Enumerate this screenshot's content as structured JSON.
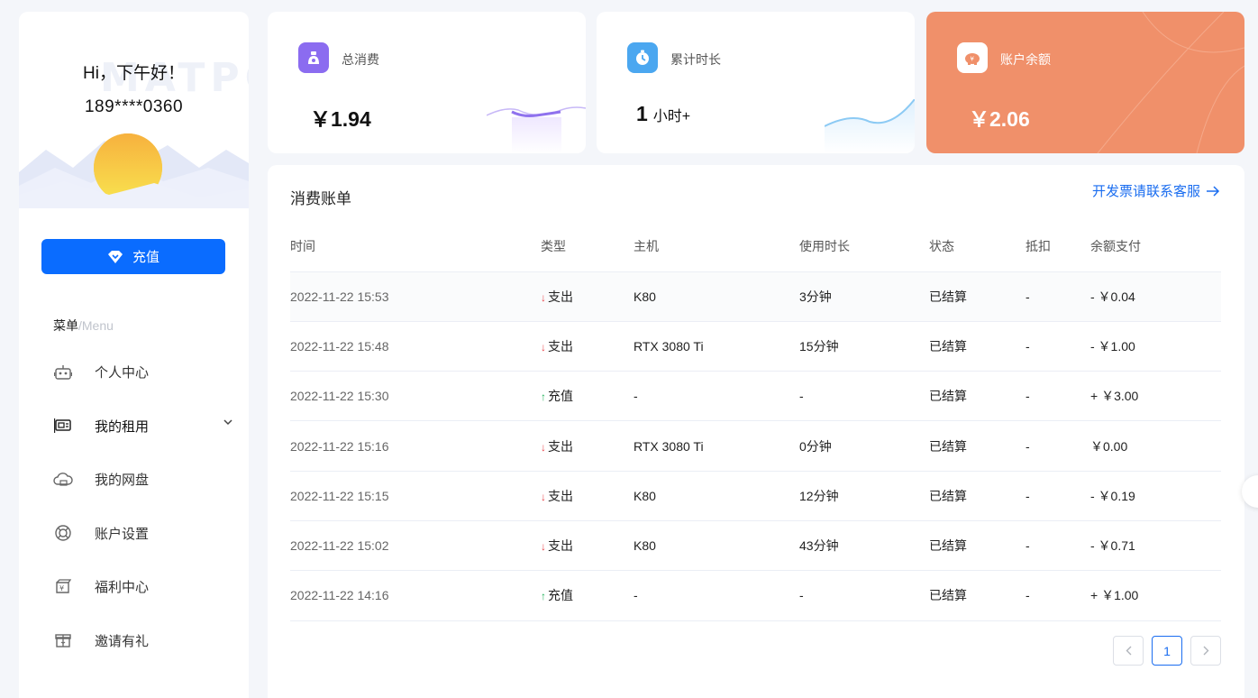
{
  "sidebar": {
    "watermark": "MATPC",
    "greeting": "Hi，下午好！",
    "phone": "189****0360",
    "recharge_label": "充值",
    "menu_title": "菜单",
    "menu_title_en": "/Menu",
    "items": [
      {
        "label": "个人中心",
        "icon": "robot-icon"
      },
      {
        "label": "我的租用",
        "icon": "gpu-card-icon"
      },
      {
        "label": "我的网盘",
        "icon": "cloud-disk-icon"
      },
      {
        "label": "账户设置",
        "icon": "settings-ring-icon"
      },
      {
        "label": "福利中心",
        "icon": "welfare-icon"
      },
      {
        "label": "邀请有礼",
        "icon": "gift-icon"
      }
    ]
  },
  "stats": {
    "total_spend": {
      "label": "总消费",
      "value": "￥1.94"
    },
    "total_time": {
      "label": "累计时长",
      "value": "1",
      "unit": "小时+"
    },
    "balance": {
      "label": "账户余额",
      "value": "￥2.06"
    }
  },
  "bill": {
    "title": "消费账单",
    "invoice_link": "开发票请联系客服",
    "columns": [
      "时间",
      "类型",
      "主机",
      "使用时长",
      "状态",
      "抵扣",
      "余额支付"
    ],
    "rows": [
      {
        "time": "2022-11-22 15:53",
        "type": "支出",
        "dir": "down",
        "host": "K80",
        "duration": "3分钟",
        "status": "已结算",
        "deduct": "-",
        "amount": "- ￥0.04"
      },
      {
        "time": "2022-11-22 15:48",
        "type": "支出",
        "dir": "down",
        "host": "RTX 3080 Ti",
        "duration": "15分钟",
        "status": "已结算",
        "deduct": "-",
        "amount": "- ￥1.00"
      },
      {
        "time": "2022-11-22 15:30",
        "type": "充值",
        "dir": "up",
        "host": "-",
        "duration": "-",
        "status": "已结算",
        "deduct": "-",
        "amount": "+ ￥3.00"
      },
      {
        "time": "2022-11-22 15:16",
        "type": "支出",
        "dir": "down",
        "host": "RTX 3080 Ti",
        "duration": "0分钟",
        "status": "已结算",
        "deduct": "-",
        "amount": "￥0.00"
      },
      {
        "time": "2022-11-22 15:15",
        "type": "支出",
        "dir": "down",
        "host": "K80",
        "duration": "12分钟",
        "status": "已结算",
        "deduct": "-",
        "amount": "- ￥0.19"
      },
      {
        "time": "2022-11-22 15:02",
        "type": "支出",
        "dir": "down",
        "host": "K80",
        "duration": "43分钟",
        "status": "已结算",
        "deduct": "-",
        "amount": "- ￥0.71"
      },
      {
        "time": "2022-11-22 14:16",
        "type": "充值",
        "dir": "up",
        "host": "-",
        "duration": "-",
        "status": "已结算",
        "deduct": "-",
        "amount": "+ ￥1.00"
      }
    ],
    "pager": {
      "current": "1"
    }
  },
  "colors": {
    "primary": "#0a6cff",
    "balance_card": "#f0906a",
    "expense": "#e8474d",
    "income": "#23b35b"
  }
}
